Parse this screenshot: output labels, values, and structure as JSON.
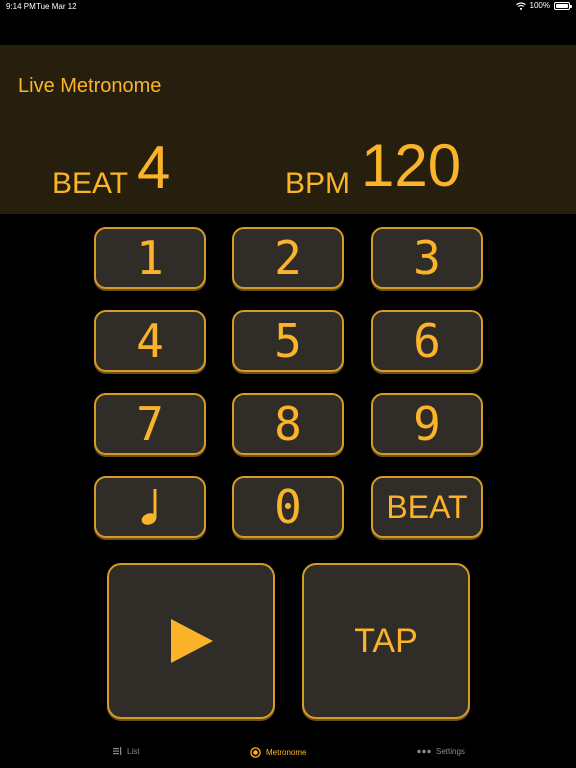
{
  "status_bar": {
    "time": "9:14 PM",
    "date": "Tue Mar 12",
    "battery": "100%"
  },
  "header": {
    "title": "Live Metronome",
    "beat_label": "BEAT",
    "beat_value": "4",
    "bpm_label": "BPM",
    "bpm_value": "120"
  },
  "keypad": {
    "keys": [
      "1",
      "2",
      "3",
      "4",
      "5",
      "6",
      "7",
      "8",
      "9"
    ],
    "note_icon": "quarter-note-icon",
    "zero": "0",
    "beat": "BEAT"
  },
  "controls": {
    "play_icon": "play-icon",
    "tap": "TAP"
  },
  "tabs": [
    {
      "label": "List",
      "icon": "list-icon"
    },
    {
      "label": "Metronome",
      "icon": "metronome-icon"
    },
    {
      "label": "Settings",
      "icon": "more-icon"
    }
  ],
  "colors": {
    "accent": "#fbb42a",
    "key_bg": "#302d29",
    "key_border": "#d69a26",
    "header_bg": "#271f0d",
    "background": "#000000"
  }
}
